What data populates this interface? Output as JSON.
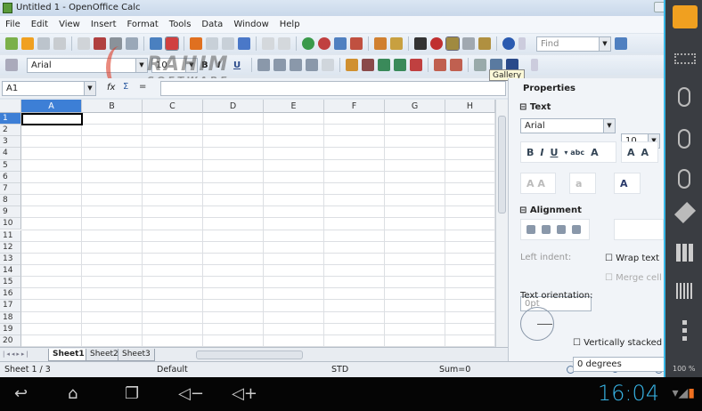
{
  "window": {
    "title": "Untitled 1 - OpenOffice Calc"
  },
  "menu": [
    "File",
    "Edit",
    "View",
    "Insert",
    "Format",
    "Tools",
    "Data",
    "Window",
    "Help"
  ],
  "toolbar": {
    "find_placeholder": "Find",
    "font_name": "Arial",
    "font_size": "10",
    "tooltip": "Gallery"
  },
  "formula": {
    "name_box": "A1",
    "fx": "fx",
    "sum": "Σ",
    "equals": "="
  },
  "watermark": {
    "line1": "RAHIM",
    "line2": "SOFTWARE"
  },
  "grid": {
    "columns": [
      "A",
      "B",
      "C",
      "D",
      "E",
      "F",
      "G",
      "H"
    ],
    "rows": [
      "1",
      "2",
      "3",
      "4",
      "5",
      "6",
      "7",
      "8",
      "9",
      "10",
      "11",
      "12",
      "13",
      "14",
      "15",
      "16",
      "17",
      "18",
      "19",
      "20"
    ],
    "active_cell": "A1"
  },
  "sheets": [
    "Sheet1",
    "Sheet2",
    "Sheet3"
  ],
  "status": {
    "sheet": "Sheet 1 / 3",
    "style": "Default",
    "mode": "STD",
    "sum": "Sum=0",
    "zoom": "100 %"
  },
  "sidebar": {
    "title": "Properties",
    "text_section": "Text",
    "font": "Arial",
    "size": "10",
    "alignment_section": "Alignment",
    "left_indent_label": "Left indent:",
    "left_indent_value": "0pt",
    "wrap_text": "Wrap text",
    "merge_cells": "Merge cell",
    "orientation_label": "Text orientation:",
    "orientation_value": "0 degrees",
    "vertically_stacked": "Vertically stacked"
  },
  "android": {
    "clock": "16:04"
  },
  "colors": {
    "accent": "#38b6e8",
    "selected_header": "#3d7fd6"
  }
}
